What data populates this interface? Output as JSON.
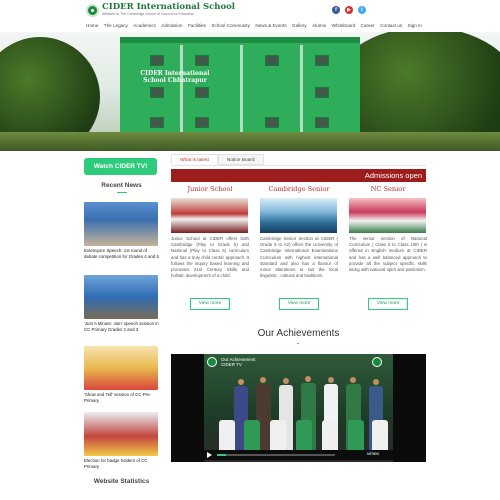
{
  "brand": {
    "name": "CIDER International School",
    "tagline": "Affiliated to The Cambridge School of Council for Education"
  },
  "nav": [
    "Home",
    "The Legacy",
    "Academics",
    "Admission",
    "Facilities",
    "School Community",
    "News & Events",
    "Gallery",
    "Alumni",
    "Whiteboard",
    "Career",
    "Contact us",
    "Sign In"
  ],
  "social": [
    "facebook-icon",
    "youtube-icon",
    "twitter-icon"
  ],
  "hero": {
    "building_sign": "CIDER International School Chhatrapur"
  },
  "sidebar": {
    "watch_label": "Watch CIDER TV!",
    "recent_news_title": "Recent News",
    "news": [
      "Extempore Speech: 1st round of debate competition for Grades 4 and 5",
      "'Just A Minute: Jam' speech session in CC Primary Grades 2 and 3",
      "'Show and Tell' session of CC Pre-Primary",
      "Election for badge holders of CC Primary"
    ],
    "stats_title": "Website Statistics"
  },
  "tabs": [
    {
      "label": "What is latest",
      "active": true
    },
    {
      "label": "Notice Board",
      "active": false
    }
  ],
  "admissions": "Admissions open",
  "columns": [
    {
      "title": "Junior School",
      "text": "Junior School at CIDER offers both Cambridge (Play to Grade 5) and National (Play to Class 5) curriculum and has a truly child centric approach. It follows the inquiry based learning and promotes 21st Century Skills and holistic development of a child.",
      "button": "View more"
    },
    {
      "title": "Cambridge Senior",
      "text": "Cambridge Senior Section at CIDER ( Grade 6 to A2) offers the University of Cambridge International Examinations Curriculum with highest international standard and also has a flavour of minor alterations to suit the local linguistic , cultural and traditions.",
      "button": "View more"
    },
    {
      "title": "NC Senior",
      "text": "The senior section of National Curriculum ( Class 5 to Class 10th ) is offered in English medium at CIDER and has a well balanced approach to provide all the subject specific skills along with national spirit and patriotism.",
      "button": "View more"
    }
  ],
  "achievements_title": "Our Achievements",
  "video": {
    "label": "Our Achievement",
    "channel": "CIDER TV",
    "provider": "vimeo",
    "progress": 0.08
  },
  "colors": {
    "brand_green": "#2ecc7a",
    "admissions_red": "#9d1c1c",
    "title_red": "#b23030"
  }
}
